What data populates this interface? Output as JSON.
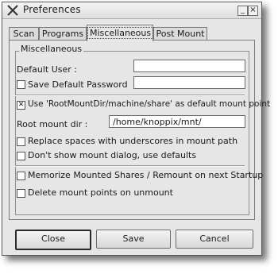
{
  "window": {
    "title": "Preferences",
    "min_symbol": "_",
    "close_symbol": "×"
  },
  "tabs": [
    {
      "label": "Scan",
      "active": false
    },
    {
      "label": "Programs",
      "active": false
    },
    {
      "label": "Miscellaneous",
      "active": true
    },
    {
      "label": "Post Mount",
      "active": false
    }
  ],
  "group": {
    "title": "Miscellaneous"
  },
  "fields": {
    "default_user": {
      "label": "Default User :",
      "value": ""
    },
    "save_default_password": {
      "label": "Save Default Password",
      "checked": false,
      "value": ""
    },
    "use_rootmountdir": {
      "label": "Use 'RootMountDir/machine/share' as default mount point",
      "checked": true
    },
    "root_mount_dir": {
      "label": "Root mount dir :",
      "value": "/home/knoppix/mnt/"
    },
    "replace_spaces": {
      "label": "Replace spaces with underscores in mount path",
      "checked": false
    },
    "dont_show_dialog": {
      "label": "Don't show mount dialog, use defaults",
      "checked": false
    },
    "memorize_shares": {
      "label": "Memorize Mounted Shares / Remount on next Startup",
      "checked": false
    },
    "delete_mount_points": {
      "label": "Delete mount points on unmount",
      "checked": false
    }
  },
  "buttons": {
    "close": "Close",
    "save": "Save",
    "cancel": "Cancel"
  },
  "check_mark": "✕"
}
